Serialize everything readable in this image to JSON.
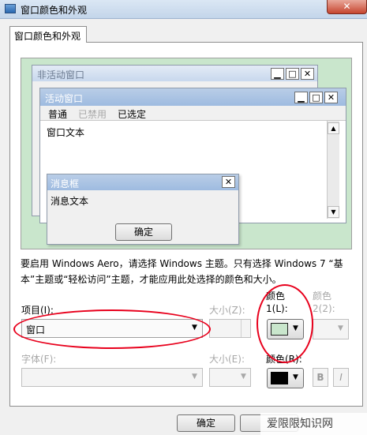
{
  "window": {
    "title": "窗口颜色和外观",
    "close": "✕"
  },
  "tab": {
    "label": "窗口颜色和外观"
  },
  "preview": {
    "inactive_title": "非活动窗口",
    "active_title": "活动窗口",
    "menu": [
      "普通",
      "已禁用",
      "已选定"
    ],
    "window_text": "窗口文本",
    "msgbox_title": "消息框",
    "msgbox_text": "消息文本",
    "ok_label": "确定",
    "minimize": "▁",
    "maximize": "□",
    "close": "✕",
    "scroll_up": "▲",
    "scroll_down": "▼"
  },
  "notice": "要启用 Windows Aero，请选择 Windows 主题。只有选择 Windows 7 “基本”主题或“轻松访问”主题，才能应用此处选择的颜色和大小。",
  "form": {
    "item_label": "项目(I):",
    "item_value": "窗口",
    "size_label": "大小(Z):",
    "color1_label": "颜色",
    "color1_sub": "1(L):",
    "color2_label": "颜色",
    "color2_sub": "2(2):",
    "font_label": "字体(F):",
    "font_size_label": "大小(E):",
    "font_color_label": "颜色(R):",
    "bold": "B",
    "italic": "I",
    "color1_value": "#c9e6cc",
    "font_color_value": "#000000"
  },
  "buttons": {
    "ok": "确定"
  },
  "watermark": "爱限限知识网"
}
